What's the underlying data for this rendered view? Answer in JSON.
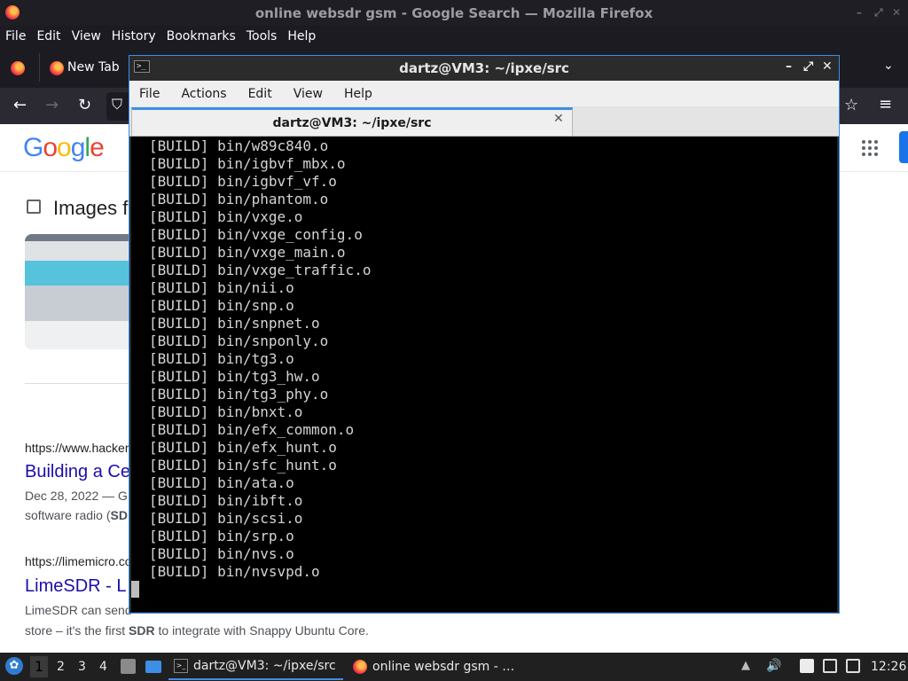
{
  "firefox": {
    "window_title": "online websdr gsm - Google Search — Mozilla Firefox",
    "menu": [
      "File",
      "Edit",
      "View",
      "History",
      "Bookmarks",
      "Tools",
      "Help"
    ],
    "tab_label": "New Tab"
  },
  "google": {
    "logo": [
      "G",
      "o",
      "o",
      "g",
      "l",
      "e"
    ],
    "images_label": "Images f",
    "results": [
      {
        "cite": "https://www.hacker",
        "title": "Building a Ce",
        "snippet_date": "Dec 28, 2022 — G",
        "snippet_line2_pre": "software radio (",
        "snippet_line2_bold": "SD"
      },
      {
        "cite": "https://limemicro.co",
        "title": "LimeSDR - L",
        "snippet_line1": "LimeSDR can send",
        "snippet_line2_pre": "store – it's the first ",
        "snippet_line2_bold": "SDR",
        "snippet_line2_post": " to integrate with Snappy Ubuntu Core."
      }
    ]
  },
  "terminal": {
    "window_title": "dartz@VM3: ~/ipxe/src",
    "menu": [
      "File",
      "Actions",
      "Edit",
      "View",
      "Help"
    ],
    "tab_label": "dartz@VM3: ~/ipxe/src",
    "lines": [
      "[BUILD] bin/w89c840.o",
      "[BUILD] bin/igbvf_mbx.o",
      "[BUILD] bin/igbvf_vf.o",
      "[BUILD] bin/phantom.o",
      "[BUILD] bin/vxge.o",
      "[BUILD] bin/vxge_config.o",
      "[BUILD] bin/vxge_main.o",
      "[BUILD] bin/vxge_traffic.o",
      "[BUILD] bin/nii.o",
      "[BUILD] bin/snp.o",
      "[BUILD] bin/snpnet.o",
      "[BUILD] bin/snponly.o",
      "[BUILD] bin/tg3.o",
      "[BUILD] bin/tg3_hw.o",
      "[BUILD] bin/tg3_phy.o",
      "[BUILD] bin/bnxt.o",
      "[BUILD] bin/efx_common.o",
      "[BUILD] bin/efx_hunt.o",
      "[BUILD] bin/sfc_hunt.o",
      "[BUILD] bin/ata.o",
      "[BUILD] bin/ibft.o",
      "[BUILD] bin/scsi.o",
      "[BUILD] bin/srp.o",
      "[BUILD] bin/nvs.o",
      "[BUILD] bin/nvsvpd.o"
    ]
  },
  "taskbar": {
    "workspaces": [
      "1",
      "2",
      "3",
      "4"
    ],
    "tasks": [
      {
        "label": "dartz@VM3: ~/ipxe/src",
        "icon": "terminal-icon"
      },
      {
        "label": "online websdr gsm - …",
        "icon": "firefox-icon"
      }
    ],
    "clock": "12:26"
  },
  "colors": {
    "accent": "#3d8ee6",
    "google_link": "#1a0dab"
  }
}
